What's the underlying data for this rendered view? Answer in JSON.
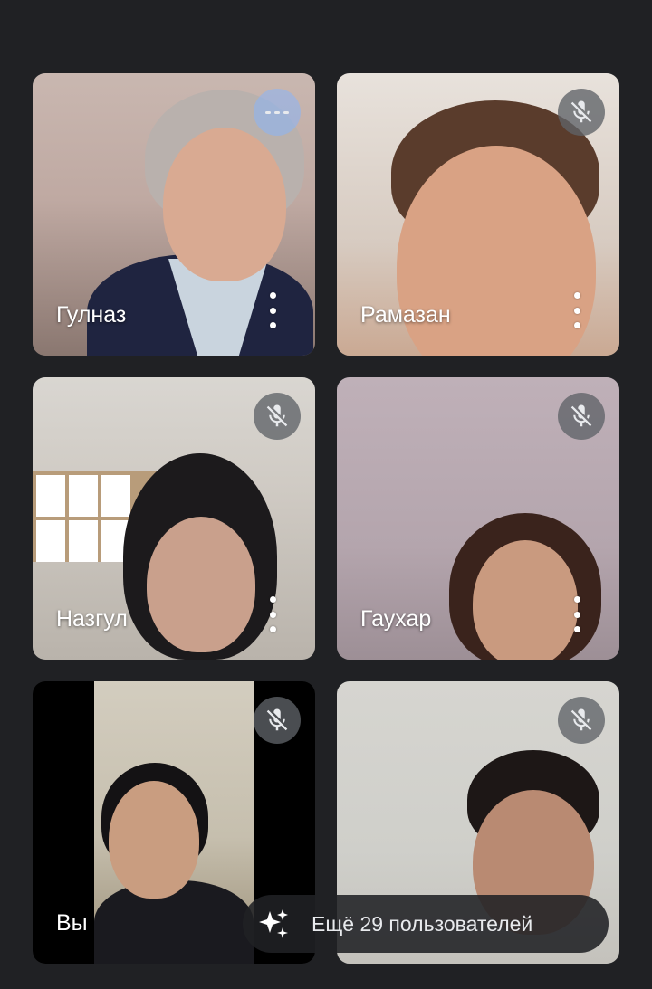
{
  "participants": [
    {
      "name": "Гулназ",
      "status": "speaking"
    },
    {
      "name": "Рамазан",
      "status": "muted"
    },
    {
      "name": "Назгул",
      "status": "muted"
    },
    {
      "name": "Гаухар",
      "status": "muted"
    },
    {
      "name": "Вы",
      "status": "muted"
    },
    {
      "name": "",
      "status": "muted"
    }
  ],
  "more_participants": {
    "label": "Ещё 29 пользователей",
    "icon": "sparkle-icon"
  },
  "icons": {
    "muted": "mic-off-icon",
    "speaking": "audio-level-icon",
    "menu": "more-vert-icon"
  },
  "colors": {
    "background": "#202124",
    "badge": "#5f6368",
    "speaking_badge": "#8ab4f8",
    "text": "#ffffff"
  }
}
